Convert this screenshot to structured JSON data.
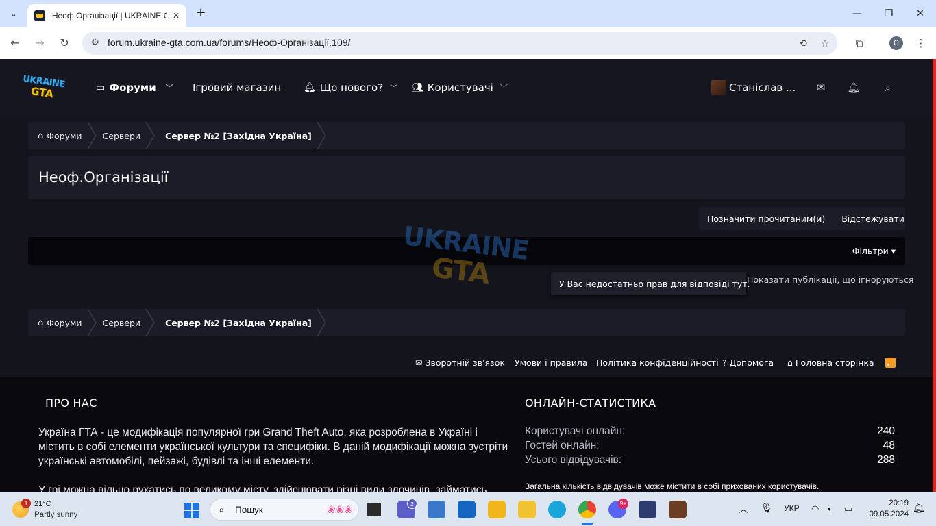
{
  "browser": {
    "tab_title": "Неоф.Організації | UKRAINE GTA",
    "url": "forum.ukraine-gta.com.ua/forums/Неоф-Організації.109/",
    "profile_letter": "C"
  },
  "header": {
    "logo_line1": "UKRAINE",
    "logo_line2": "GTA",
    "nav": [
      {
        "label": "Форуми"
      },
      {
        "label": "Ігровий магазин"
      },
      {
        "label": "Що нового?"
      },
      {
        "label": "Користувачі"
      }
    ],
    "user_name": "Станіслав ..."
  },
  "breadcrumb": [
    "Форуми",
    "Сервери",
    "Сервер №2 [Західна Україна]"
  ],
  "page_title": "Неоф.Організації",
  "actions": {
    "mark_read": "Позначити прочитаним(и)",
    "watch": "Відстежувати"
  },
  "filters_label": "Фільтри",
  "watermark": {
    "line1": "UKRAINE",
    "line2": "GTA"
  },
  "tooltip": "У Вас недостатньо прав для відповіді тут.",
  "show_ignored": "Показати публікації, що ігноруються",
  "footer_links": [
    "Зворотній зв'язок",
    "Умови і правила",
    "Політика конфіденційності",
    "Допомога",
    "Головна сторінка"
  ],
  "about": {
    "title": "ПРО НАС",
    "paragraph1": "Україна ГТА - це модифікація популярної гри Grand Theft Auto, яка розроблена в Україні і містить в собі елементи української культури та специфіки. В даній модифікації можна зустріти українські автомобілі, пейзажі, будівлі та інші елементи.",
    "paragraph2": "У грі можна вільно рухатись по великому місту, здійснювати різні види злочинів, займатись"
  },
  "stats": {
    "title": "ОНЛАЙН-СТАТИСТИКА",
    "rows": [
      {
        "label": "Користувачі онлайн:",
        "value": "240"
      },
      {
        "label": "Гостей онлайн:",
        "value": "48"
      },
      {
        "label": "Усього відвідувачів:",
        "value": "288"
      }
    ],
    "note": "Загальна кількість відвідувачів може містити в собі прихованих користувачів."
  },
  "taskbar": {
    "weather_temp": "21°C",
    "weather_desc": "Partly sunny",
    "weather_badge": "1",
    "search_placeholder": "Пошук",
    "teams_badge": "2",
    "discord_badge": "9+",
    "language": "УКР",
    "time": "20:19",
    "date": "09.05.2024"
  },
  "colors": {
    "page_bg": "#13141c",
    "panel_bg": "#1b1c27",
    "accent_red": "#d9291e",
    "rss_orange": "#f59a23"
  }
}
